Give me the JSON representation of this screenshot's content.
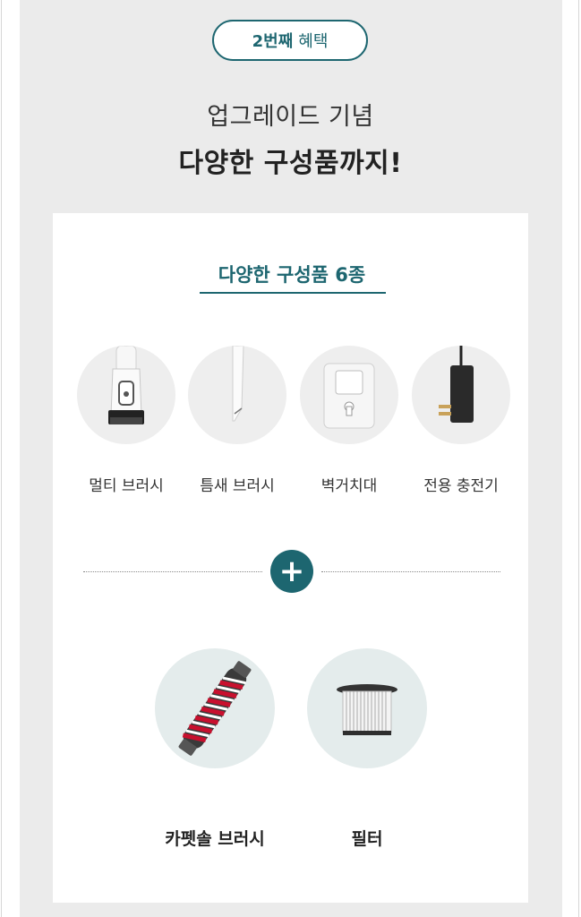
{
  "benefit_badge": {
    "number": "2번째",
    "text": "혜택"
  },
  "headline": {
    "subtitle": "업그레이드 기념",
    "title": "다양한 구성품까지!"
  },
  "card": {
    "heading": "다양한 구성품 6종",
    "items": [
      {
        "label": "멀티 브러시",
        "icon": "multi-brush-icon"
      },
      {
        "label": "틈새 브러시",
        "icon": "crevice-brush-icon"
      },
      {
        "label": "벽거치대",
        "icon": "wall-mount-icon"
      },
      {
        "label": "전용 충전기",
        "icon": "charger-icon"
      }
    ],
    "plus_symbol": "+",
    "extra_items": [
      {
        "label": "카펫솔 브러시",
        "icon": "carpet-brush-icon"
      },
      {
        "label": "필터",
        "icon": "filter-icon"
      }
    ]
  },
  "colors": {
    "accent": "#1d6670",
    "background": "#ebebeb",
    "circle_gray": "#eeeeee",
    "circle_teal": "#e4ecec"
  }
}
